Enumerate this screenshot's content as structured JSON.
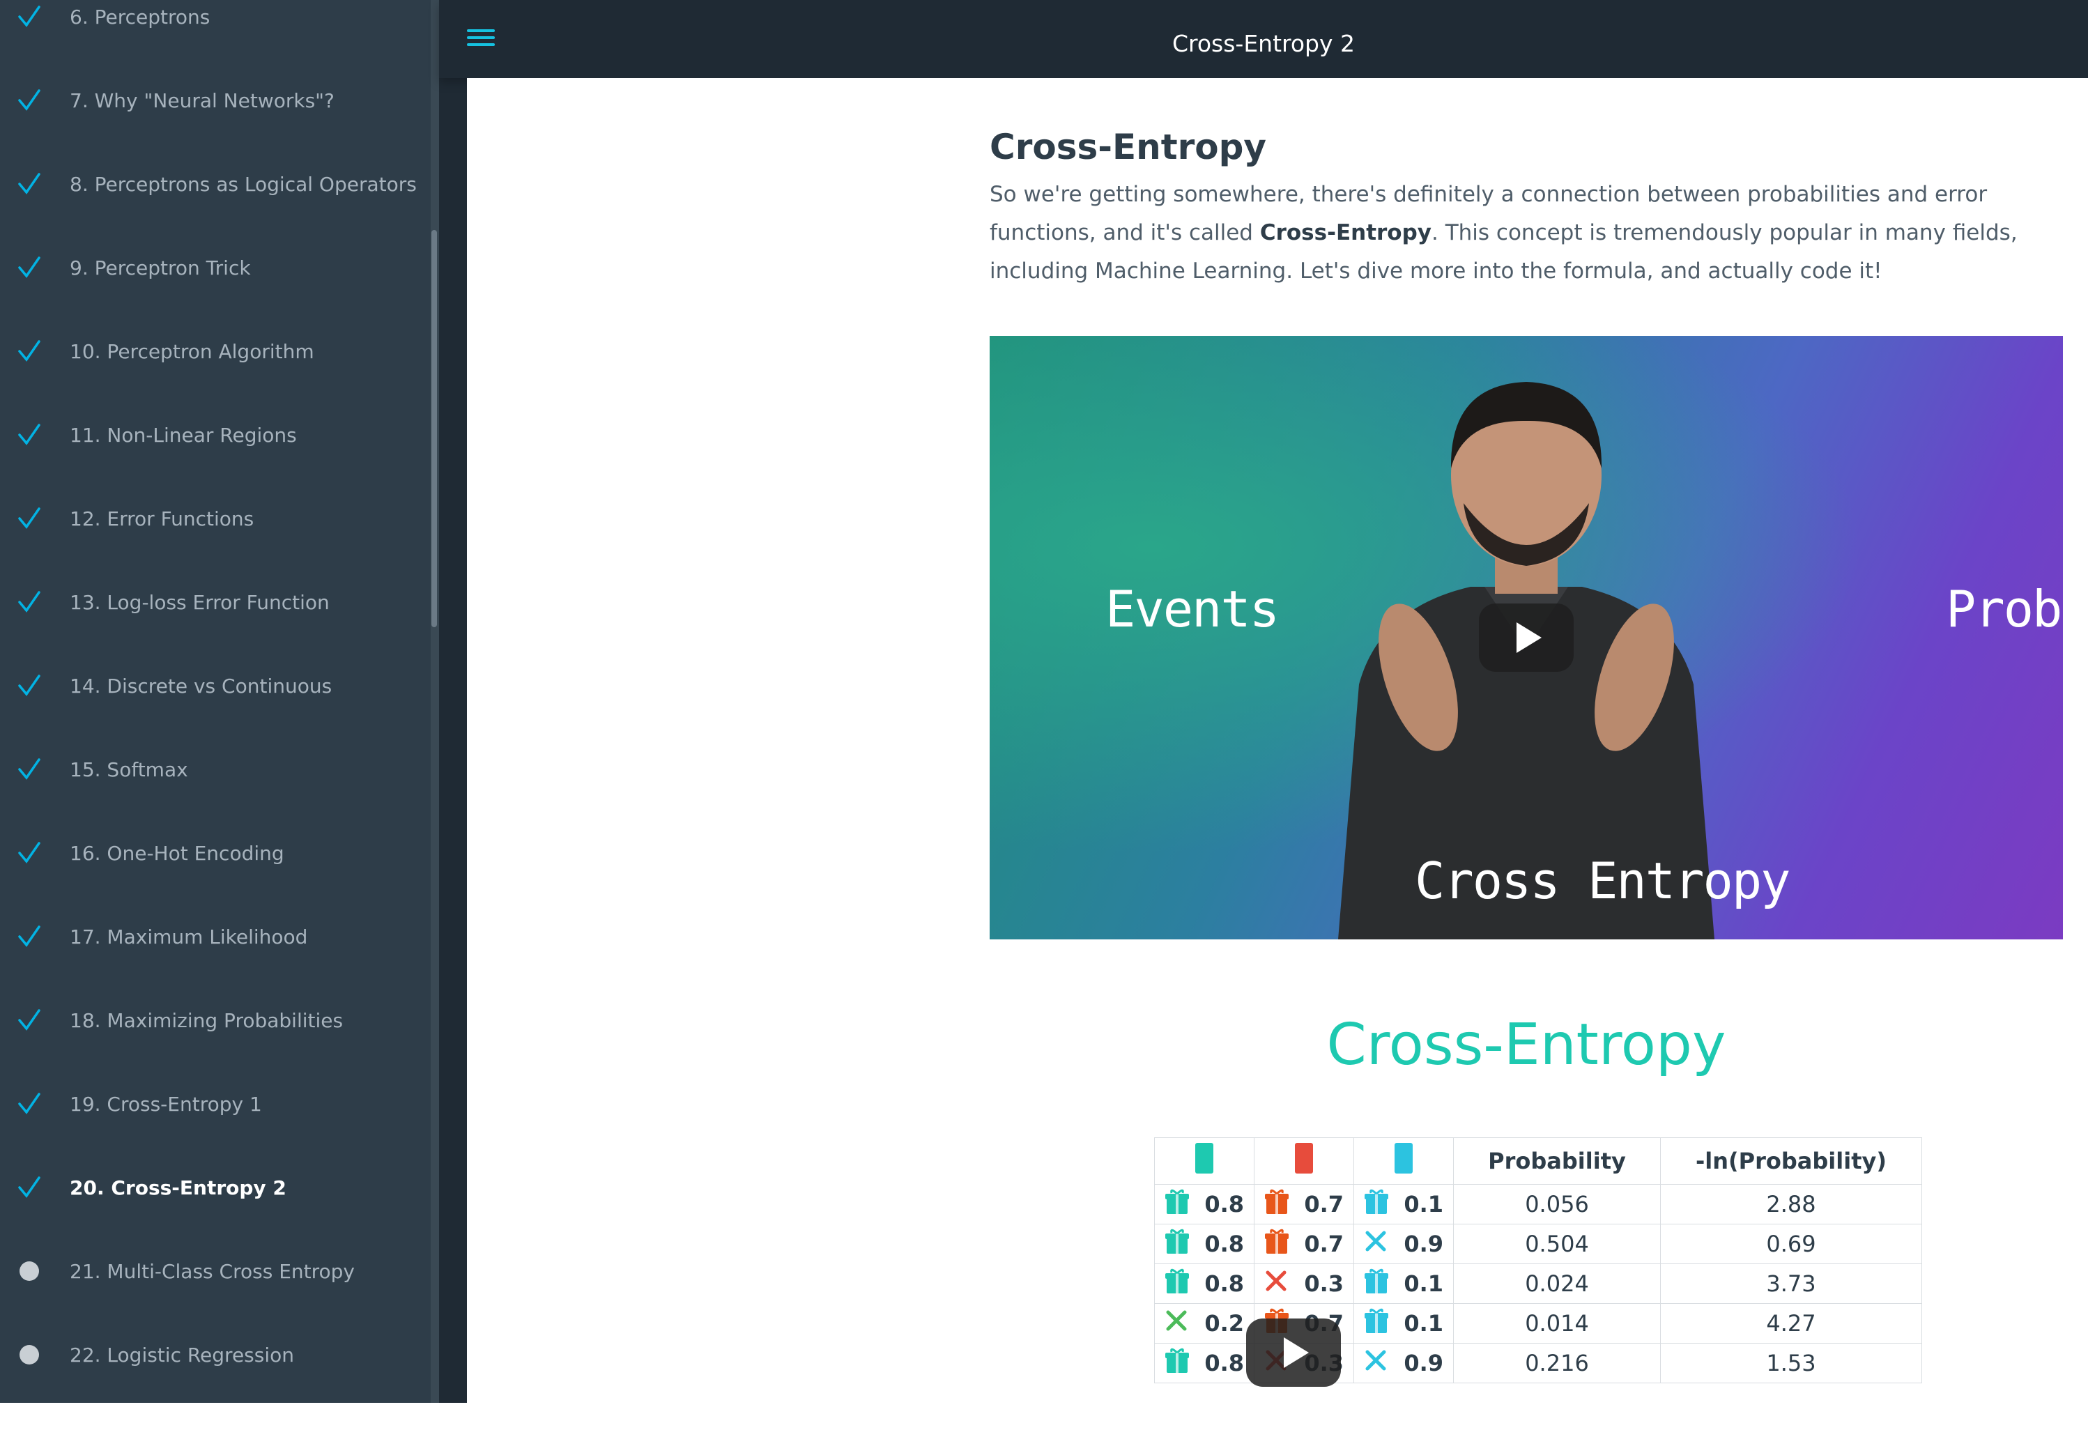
{
  "header": {
    "title": "Cross-Entropy 2"
  },
  "sidebar": {
    "items": [
      {
        "label": "6. Perceptrons",
        "status": "done"
      },
      {
        "label": "7. Why \"Neural Networks\"?",
        "status": "done"
      },
      {
        "label": "8. Perceptrons as Logical Operators",
        "status": "done"
      },
      {
        "label": "9. Perceptron Trick",
        "status": "done"
      },
      {
        "label": "10. Perceptron Algorithm",
        "status": "done"
      },
      {
        "label": "11. Non-Linear Regions",
        "status": "done"
      },
      {
        "label": "12. Error Functions",
        "status": "done"
      },
      {
        "label": "13. Log-loss Error Function",
        "status": "done"
      },
      {
        "label": "14. Discrete vs Continuous",
        "status": "done"
      },
      {
        "label": "15. Softmax",
        "status": "done"
      },
      {
        "label": "16. One-Hot Encoding",
        "status": "done"
      },
      {
        "label": "17. Maximum Likelihood",
        "status": "done"
      },
      {
        "label": "18. Maximizing Probabilities",
        "status": "done"
      },
      {
        "label": "19. Cross-Entropy 1",
        "status": "done"
      },
      {
        "label": "20. Cross-Entropy 2",
        "status": "active"
      },
      {
        "label": "21. Multi-Class Cross Entropy",
        "status": "pending"
      },
      {
        "label": "22. Logistic Regression",
        "status": "pending"
      }
    ]
  },
  "content": {
    "heading": "Cross-Entropy",
    "para_start": "So we're getting somewhere, there's definitely a connection between probabilities and error functions, and it's called ",
    "para_bold": "Cross-Entropy",
    "para_end": ". This concept is tremendously popular in many fields, including Machine Learning. Let's dive more into the formula, and actually code it!"
  },
  "video": {
    "left_word": "Events",
    "right_word": "Prob",
    "bottom_word": "Cross Entropy"
  },
  "figure": {
    "title": "Cross-Entropy",
    "headers": [
      "Probability",
      "-ln(Probability)"
    ],
    "rows": [
      {
        "a": "0.8",
        "b": "0.7",
        "c": "0.1",
        "prob": "0.056",
        "ln": "2.88",
        "ai": "gift",
        "bi": "gift",
        "ci": "gift"
      },
      {
        "a": "0.8",
        "b": "0.7",
        "c": "0.9",
        "prob": "0.504",
        "ln": "0.69",
        "ai": "gift",
        "bi": "gift",
        "ci": "x"
      },
      {
        "a": "0.8",
        "b": "0.3",
        "c": "0.1",
        "prob": "0.024",
        "ln": "3.73",
        "ai": "gift",
        "bi": "x",
        "ci": "gift"
      },
      {
        "a": "0.2",
        "b": "0.7",
        "c": "0.1",
        "prob": "0.014",
        "ln": "4.27",
        "ai": "x",
        "bi": "gift",
        "ci": "gift"
      },
      {
        "a": "0.8",
        "b": "0.3",
        "c": "0.9",
        "prob": "0.216",
        "ln": "1.53",
        "ai": "gift",
        "bi": "x",
        "ci": "x"
      }
    ]
  },
  "colors": {
    "sidebar_bg": "#2e3d49",
    "header_bg": "#1f2a34",
    "accent": "#15c1e0",
    "check": "#02b3e4",
    "teal": "#1ec9b0",
    "red": "#e74c3c",
    "cyan": "#2cc3e0"
  }
}
